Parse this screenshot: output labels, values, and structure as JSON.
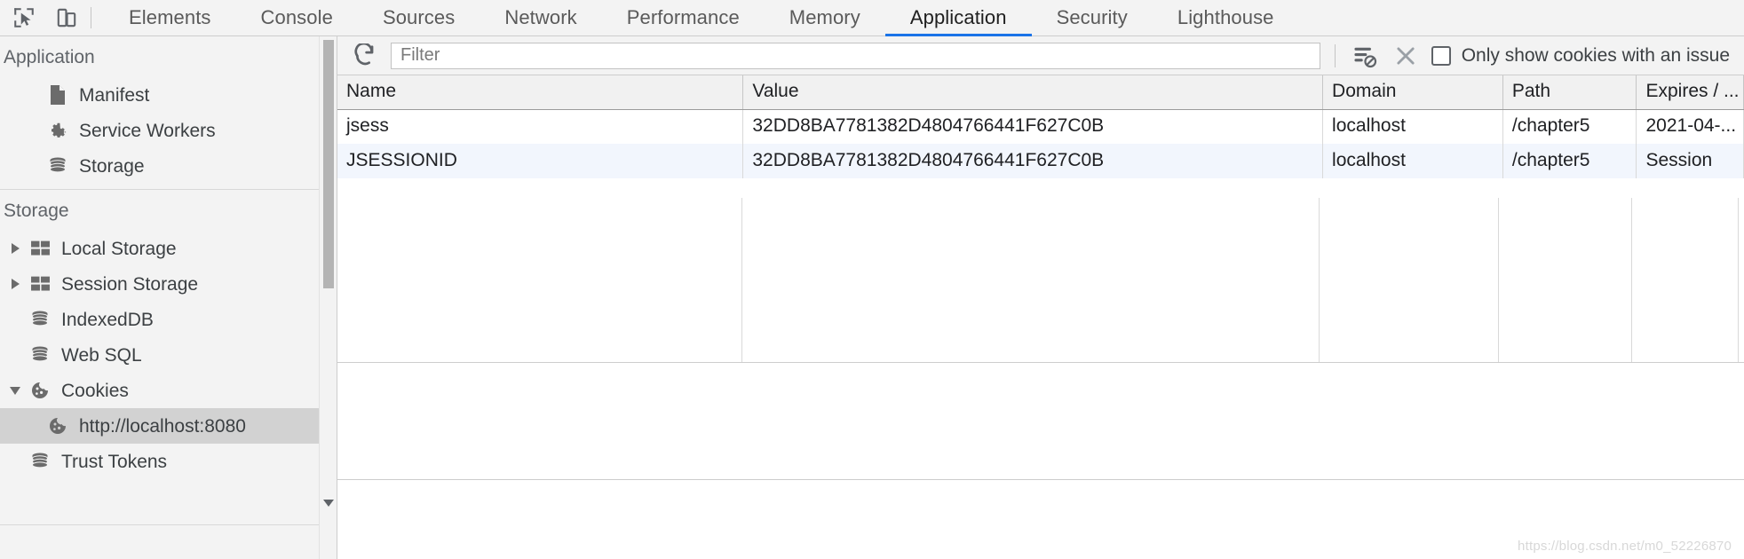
{
  "tabbar": {
    "inspect_icon": "inspect-cursor-icon",
    "device_icon": "device-toolbar-icon",
    "tabs": [
      {
        "label": "Elements",
        "active": false
      },
      {
        "label": "Console",
        "active": false
      },
      {
        "label": "Sources",
        "active": false
      },
      {
        "label": "Network",
        "active": false
      },
      {
        "label": "Performance",
        "active": false
      },
      {
        "label": "Memory",
        "active": false
      },
      {
        "label": "Application",
        "active": true
      },
      {
        "label": "Security",
        "active": false
      },
      {
        "label": "Lighthouse",
        "active": false
      }
    ],
    "active_tab_color": "#1a73e8"
  },
  "sidebar": {
    "application_section": {
      "title": "Application",
      "items": [
        {
          "label": "Manifest",
          "icon": "document-icon",
          "arrow": "none",
          "indent": 1,
          "selected": false
        },
        {
          "label": "Service Workers",
          "icon": "gear-icon",
          "arrow": "none",
          "indent": 1,
          "selected": false
        },
        {
          "label": "Storage",
          "icon": "database-icon",
          "arrow": "none",
          "indent": 1,
          "selected": false
        }
      ]
    },
    "storage_section": {
      "title": "Storage",
      "items": [
        {
          "label": "Local Storage",
          "icon": "table-grid-icon",
          "arrow": "right",
          "indent": 0,
          "selected": false
        },
        {
          "label": "Session Storage",
          "icon": "table-grid-icon",
          "arrow": "right",
          "indent": 0,
          "selected": false
        },
        {
          "label": "IndexedDB",
          "icon": "database-icon",
          "arrow": "none",
          "indent": 0,
          "selected": false
        },
        {
          "label": "Web SQL",
          "icon": "database-icon",
          "arrow": "none",
          "indent": 0,
          "selected": false
        },
        {
          "label": "Cookies",
          "icon": "cookie-icon",
          "arrow": "down",
          "indent": 0,
          "selected": false
        },
        {
          "label": "http://localhost:8080",
          "icon": "cookie-icon",
          "arrow": "none",
          "indent": 1,
          "selected": true
        },
        {
          "label": "Trust Tokens",
          "icon": "database-icon",
          "arrow": "none",
          "indent": 0,
          "selected": false
        }
      ]
    }
  },
  "toolbar": {
    "refresh_icon": "refresh-icon",
    "clear_filter_icon": "clear-filter-icon",
    "clear_all_icon": "close-x-icon",
    "filter_placeholder": "Filter",
    "filter_value": "",
    "only_issues_label": "Only show cookies with an issue",
    "only_issues_checked": false
  },
  "cookie_table": {
    "columns": [
      "Name",
      "Value",
      "Domain",
      "Path",
      "Expires / ..."
    ],
    "rows": [
      {
        "name": "jsess",
        "value": "32DD8BA7781382D4804766441F627C0B",
        "domain": "localhost",
        "path": "/chapter5",
        "expires": "2021-04-..."
      },
      {
        "name": "JSESSIONID",
        "value": "32DD8BA7781382D4804766441F627C0B",
        "domain": "localhost",
        "path": "/chapter5",
        "expires": "Session"
      }
    ]
  },
  "footer": {
    "watermark": "https://blog.csdn.net/m0_52226870"
  }
}
